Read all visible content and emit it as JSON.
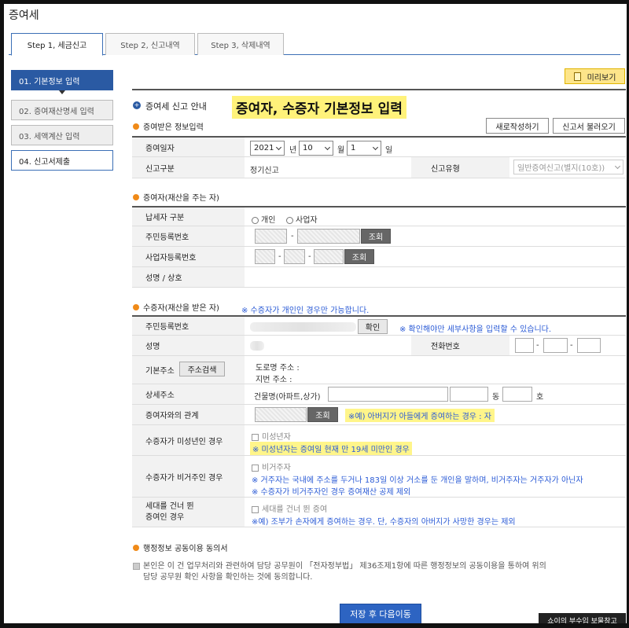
{
  "page_title": "증여세",
  "tabs": [
    "Step 1, 세금신고",
    "Step 2, 신고내역",
    "Step 3, 삭제내역"
  ],
  "sidebar": [
    "01. 기본정보 입력",
    "02. 증여재산명세 입력",
    "03. 세액계산 입력",
    "04. 신고서제출"
  ],
  "preview_label": "미리보기",
  "guide_title": "증여세 신고 안내",
  "highlight_text": "증여자, 수증자 기본정보 입력",
  "sec_received": {
    "title": "증여받은 정보입력",
    "new_btn": "새로작성하기",
    "load_btn": "신고서 불러오기",
    "date_label": "증여일자",
    "year": "2021",
    "year_unit": "년",
    "month": "10",
    "month_unit": "월",
    "day": "1",
    "day_unit": "일",
    "type_label": "신고구분",
    "type_value": "정기신고",
    "kind_label": "신고유형",
    "kind_value": "일반증여신고(별지(10호))"
  },
  "sec_giver": {
    "title": "증여자(재산을 주는 자)",
    "taxpayer_label": "납세자 구분",
    "opt_individual": "개인",
    "opt_business": "사업자",
    "rrn_label": "주민등록번호",
    "brn_label": "사업자등록번호",
    "name_label": "성명 / 상호",
    "lookup": "조회",
    "dash": "-"
  },
  "sec_receiver": {
    "title": "수증자(재산을 받은 자)",
    "title_note": "※ 수증자가 개인인 경우만 가능합니다.",
    "rrn_label": "주민등록번호",
    "confirm_btn": "확인",
    "confirm_note": "※ 확인해야만 세부사항을 입력할 수 있습니다.",
    "name_label": "성명",
    "phone_label": "전화번호",
    "addr_label": "기본주소",
    "addr_search": "주소검색",
    "road_addr": "도로명 주소 :",
    "lot_addr": "지번 주소 :",
    "detail_label": "상세주소",
    "building": "건물명(아파트,상가)",
    "dong": "동",
    "ho": "호",
    "relation_label": "증여자와의 관계",
    "lookup": "조회",
    "relation_note": "※예) 아버지가 아들에게 증여하는 경우 : 자",
    "minor_label": "수증자가 미성년인 경우",
    "minor_chk": "미성년자",
    "minor_note": "※ 미성년자는 증여일 현재 만 19세 미만인 경우",
    "nonres_label": "수증자가 비거주인 경우",
    "nonres_chk": "비거주자",
    "nonres_note1": "※ 거주자는 국내에 주소를 두거나 183일 이상 거소를 둔 개인을 말하며, 비거주자는 거주자가 아닌자",
    "nonres_note2": "※ 수증자가 비거주자인 경우 증여재산 공제 제외",
    "skip_label_1": "세대를 건너 뛴",
    "skip_label_2": "증여인 경우",
    "skip_chk": "세대를 건너 뛴 증여",
    "skip_note": "※예) 조부가 손자에게 증여하는 경우. 단, 수증자의 아버지가 사망한 경우는 제외"
  },
  "sec_consent": {
    "title": "행정정보 공동이용 동의서",
    "text_1": "본인은 이 건 업무처리와 관련하여 담당 공무원이 「전자정부법」 제36조제1항에 따른 행정정보의 공동이용을 통하여 위의",
    "text_2": "담당 공무원 확인 사항을 확인하는 것에 동의합니다."
  },
  "save_label": "저장 후 다음이동",
  "watermark": "쇼이의 부수입 보물창고"
}
